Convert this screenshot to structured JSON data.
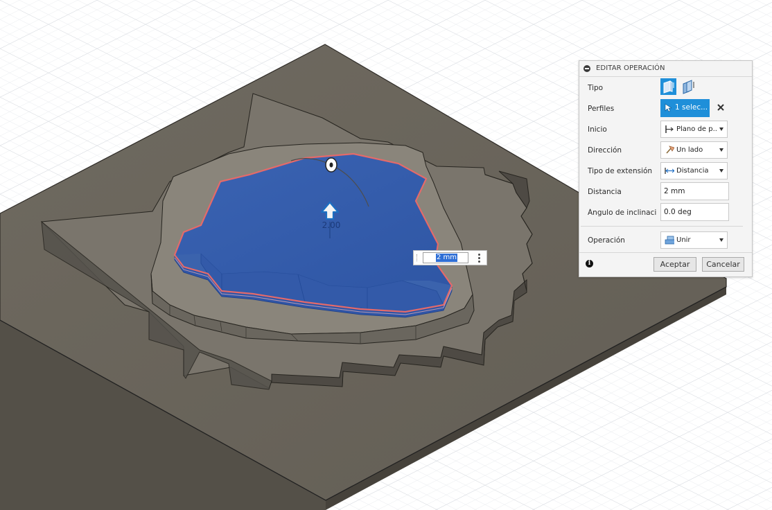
{
  "viewport": {
    "distance_handle_label": "2.00"
  },
  "floating_input": {
    "value": "2 mm"
  },
  "dialog": {
    "title": "EDITAR OPERACIÓN",
    "rows": {
      "tipo": {
        "label": "Tipo"
      },
      "perfiles": {
        "label": "Perfiles",
        "value": "1 selec..."
      },
      "inicio": {
        "label": "Inicio",
        "value": "Plano de p..."
      },
      "direccion": {
        "label": "Dirección",
        "value": "Un lado"
      },
      "tipo_extension": {
        "label": "Tipo de extensión",
        "value": "Distancia"
      },
      "distancia": {
        "label": "Distancia",
        "value": "2 mm"
      },
      "angulo": {
        "label": "Ángulo de inclinaci...",
        "value": "0.0 deg"
      },
      "operacion": {
        "label": "Operación",
        "value": "Unir"
      }
    },
    "buttons": {
      "accept": "Aceptar",
      "cancel": "Cancelar"
    }
  },
  "colors": {
    "accent": "#1f8fd9",
    "selection_face": "#2e5aad",
    "model_gray": "#6b665d",
    "profile_outline": "#e46a6a"
  },
  "icons": {
    "tipo_solid": "extrude-solid-icon",
    "tipo_thin": "extrude-thin-icon",
    "perfiles": "select-pointer-icon",
    "clear": "close-icon",
    "inicio": "profile-plane-icon",
    "direccion": "one-side-icon",
    "tipo_extension": "distance-icon",
    "operacion": "join-icon",
    "footer": "info-icon",
    "handle": "arrow-up-icon"
  }
}
